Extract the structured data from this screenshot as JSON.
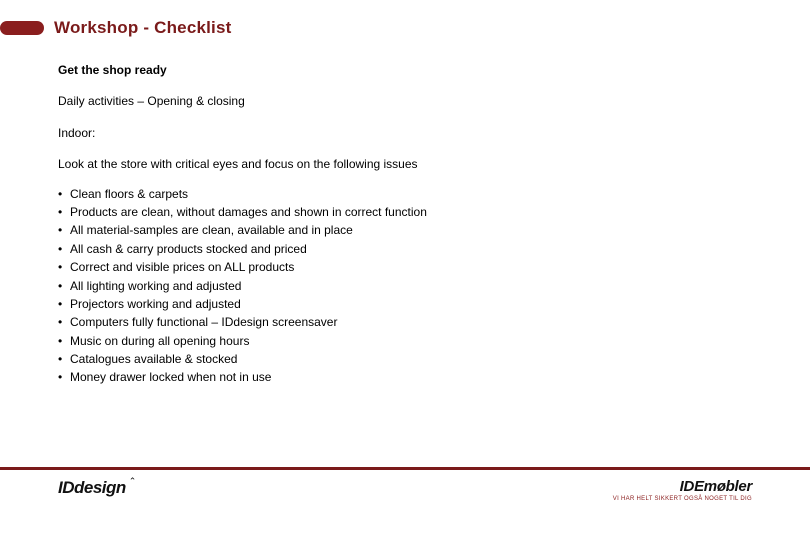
{
  "title": "Workshop - Checklist",
  "heading": "Get the shop ready",
  "subtitle": "Daily activities – Opening & closing",
  "section": "Indoor:",
  "lead": "Look at the store with critical eyes and focus on the following issues",
  "items": [
    "Clean floors & carpets",
    "Products are clean, without damages and shown in correct function",
    "All material-samples are clean, available and in place",
    "All cash & carry products stocked and priced",
    "Correct and visible prices on ALL products",
    "All lighting working and adjusted",
    "Projectors working and adjusted",
    "Computers fully functional – IDdesign screensaver",
    "Music on during all opening hours",
    "Catalogues available & stocked",
    "Money drawer locked when not in use"
  ],
  "brand_left": {
    "name": "IDdesign",
    "mark": "⌃"
  },
  "brand_right": {
    "name": "IDEmøbler",
    "tagline": "VI HAR HELT SIKKERT OGSÅ NOGET TIL DIG"
  },
  "colors": {
    "accent": "#7a1a1a"
  }
}
